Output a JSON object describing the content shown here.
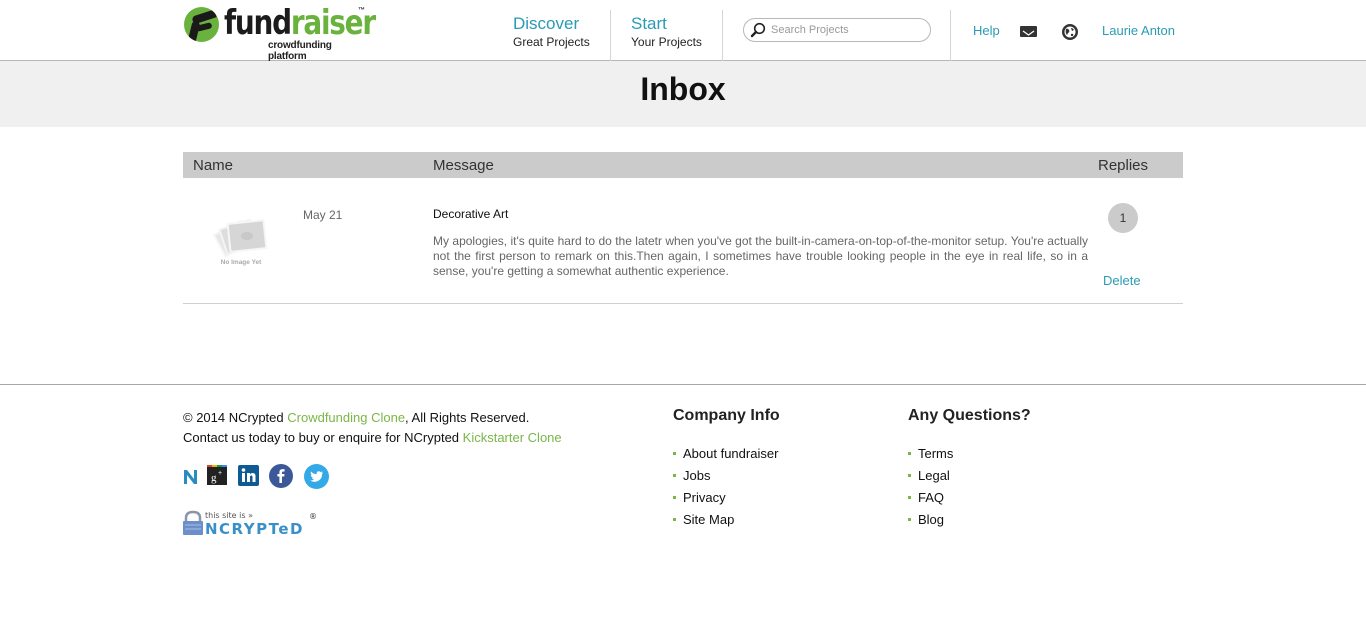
{
  "header": {
    "logo": {
      "dark_text": "fund",
      "green_text": "raiser",
      "tm": "™",
      "tagline": "crowdfunding platform"
    },
    "nav": [
      {
        "big": "Discover",
        "small": "Great Projects"
      },
      {
        "big": "Start",
        "small": "Your Projects"
      }
    ],
    "search": {
      "placeholder": "Search Projects",
      "value": ""
    },
    "help_label": "Help",
    "user_name": "Laurie Anton",
    "icons": [
      "mail-icon",
      "globe-icon"
    ]
  },
  "page": {
    "title": "Inbox"
  },
  "inbox": {
    "columns": {
      "name": "Name",
      "message": "Message",
      "replies": "Replies"
    },
    "rows": [
      {
        "avatar_label": "No Image Yet",
        "date": "May 21",
        "subject": "Decorative Art",
        "message": "My apologies, it's quite hard to do the latetr when you've got the built-in-camera-on-top-of-the-monitor setup. You're actually not the first person to remark on this.Then again, I sometimes have trouble looking people in the eye in real life, so in a sense, you're getting a somewhat authentic experience.",
        "replies": "1",
        "delete_label": "Delete"
      }
    ]
  },
  "footer": {
    "copyright_prefix": "© 2014 NCrypted ",
    "copyright_link": "Crowdfunding Clone",
    "copyright_suffix": ", All Rights Reserved.",
    "contact_prefix": "Contact us today to buy or enquire for NCrypted ",
    "contact_link": "Kickstarter Clone",
    "social_icons": [
      "ncrypted-icon",
      "google-plus-icon",
      "linkedin-icon",
      "facebook-icon",
      "twitter-icon"
    ],
    "badge": {
      "line1": "this site is »",
      "line2": "NCRYPTeD",
      "reg": "®"
    },
    "company_info": {
      "title": "Company Info",
      "items": [
        "About fundraiser",
        "Jobs",
        "Privacy",
        "Site Map"
      ]
    },
    "questions": {
      "title": "Any Questions?",
      "items": [
        "Terms",
        "Legal",
        "FAQ",
        "Blog"
      ]
    }
  },
  "colors": {
    "accent_blue": "#2a9bb5",
    "brand_green": "#6ab23e",
    "link_green": "#7ab648",
    "header_gray": "#cbcbcb",
    "band_gray": "#f0f0f0"
  }
}
